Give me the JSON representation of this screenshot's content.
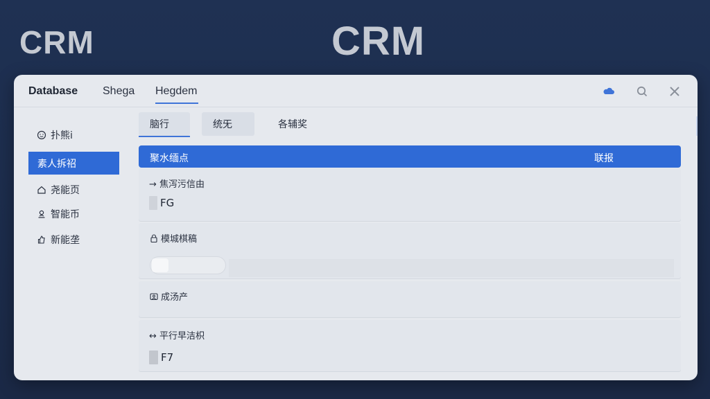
{
  "brand": {
    "left": "CRM",
    "center": "CRM"
  },
  "topbar": {
    "title": "Database",
    "nav": [
      "Shega",
      "Hegdem"
    ],
    "icons": [
      "cloud-icon",
      "search-icon",
      "close-icon"
    ]
  },
  "sidebar": {
    "items": [
      {
        "label": "扑熊i",
        "icon": "face-icon"
      },
      {
        "label": "素人拆祒",
        "icon": "",
        "active": true
      },
      {
        "label": "尧能页",
        "icon": "home-icon"
      },
      {
        "label": "智能币",
        "icon": "user-pin-icon"
      },
      {
        "label": "新能垄",
        "icon": "thumbs-up-icon"
      }
    ]
  },
  "tabs": [
    "脑行",
    "统旡",
    "各辅奖"
  ],
  "table_header": {
    "col1": "聚水缅点",
    "col2": "联报"
  },
  "fields": [
    {
      "label": "→ 焦泻污信由",
      "value": "FG"
    },
    {
      "label": "模城棋稿",
      "value": ""
    },
    {
      "label": "成汤产",
      "value": ""
    },
    {
      "label": "↔ 平行早洁枳",
      "value": "F7"
    }
  ],
  "colors": {
    "accent": "#2f6ad6",
    "background": "#1f3153",
    "panel": "#e6e9ee"
  }
}
